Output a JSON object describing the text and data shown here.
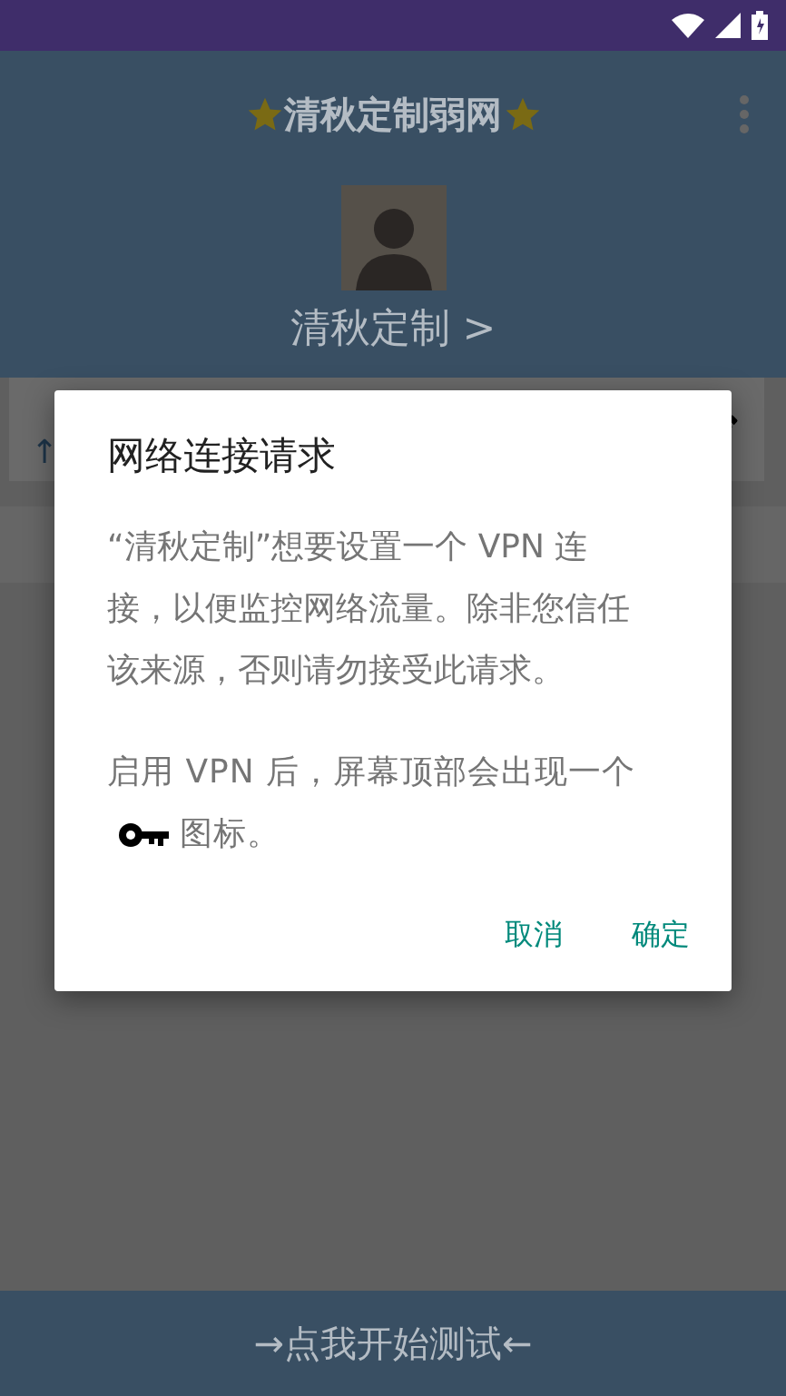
{
  "app_bar": {
    "title": "清秋定制弱网"
  },
  "profile": {
    "name": "清秋定制 >"
  },
  "card": {
    "line_2": "↑"
  },
  "dialog": {
    "title": "网络连接请求",
    "message": "“清秋定制”想要设置一个 VPN 连接，以便监控网络流量。除非您信任该来源，否则请勿接受此请求。",
    "note_before": "启用 VPN 后，屏幕顶部会出现一个",
    "note_after": "图标。",
    "buttons": [
      "取消",
      "确定"
    ]
  },
  "bottom_bar": {
    "label": "→点我开始测试←"
  }
}
